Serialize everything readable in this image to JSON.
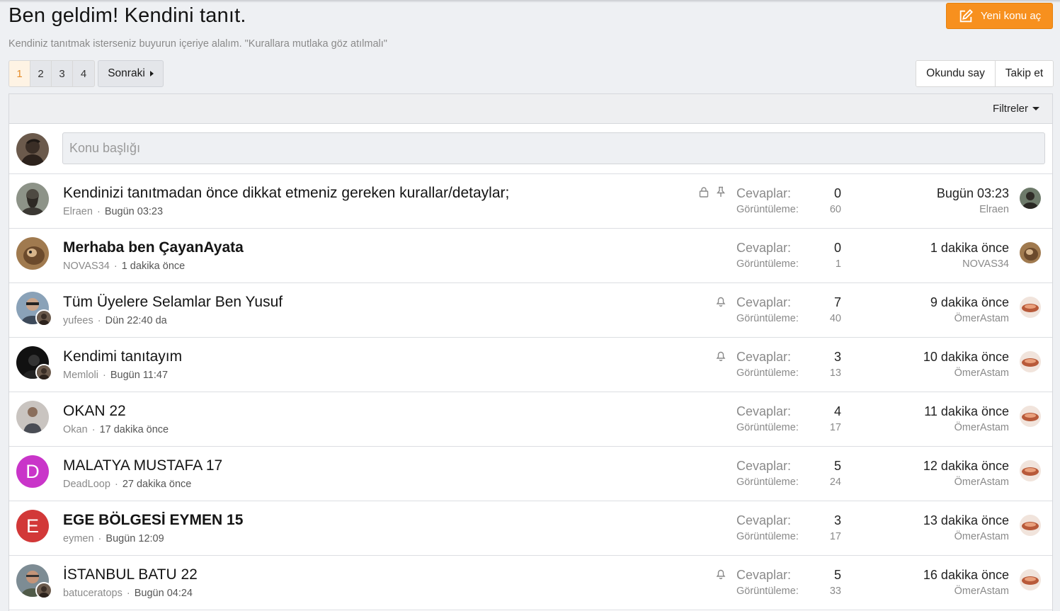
{
  "header": {
    "title": "Ben geldim! Kendini tanıt.",
    "description": "Kendiniz tanıtmak isterseniz buyurun içeriye alalım. \"Kurallara mutlaka göz atılmalı\"",
    "new_thread_label": "Yeni konu aç"
  },
  "pagination": {
    "pages": [
      "1",
      "2",
      "3",
      "4"
    ],
    "current": "1",
    "next_label": "Sonraki"
  },
  "actions": {
    "mark_read_label": "Okundu say",
    "watch_label": "Takip et"
  },
  "filters": {
    "label": "Filtreler"
  },
  "quick_thread": {
    "placeholder": "Konu başlığı"
  },
  "labels": {
    "replies": "Cevaplar:",
    "views": "Görüntüleme:"
  },
  "threads": [
    {
      "title": "Kendinizi tanıtmadan önce dikkat etmeniz gereken kurallar/detaylar;",
      "author": "Elraen",
      "date": "Bugün 03:23",
      "replies": "0",
      "views": "60",
      "last_date": "Bugün 03:23",
      "last_user": "Elraen",
      "unread": false,
      "icons": [
        "lock-icon",
        "pin-icon"
      ]
    },
    {
      "title": "Merhaba ben ÇayanAyata",
      "author": "NOVAS34",
      "date": "1 dakika önce",
      "replies": "0",
      "views": "1",
      "last_date": "1 dakika önce",
      "last_user": "NOVAS34",
      "unread": true,
      "icons": []
    },
    {
      "title": "Tüm Üyelere Selamlar Ben Yusuf",
      "author": "yufees",
      "date": "Dün 22:40 da",
      "replies": "7",
      "views": "40",
      "last_date": "9 dakika önce",
      "last_user": "ÖmerAstam",
      "unread": false,
      "icons": [
        "bell-icon"
      ]
    },
    {
      "title": "Kendimi tanıtayım",
      "author": "Memloli",
      "date": "Bugün 11:47",
      "replies": "3",
      "views": "13",
      "last_date": "10 dakika önce",
      "last_user": "ÖmerAstam",
      "unread": false,
      "icons": [
        "bell-icon"
      ]
    },
    {
      "title": "OKAN 22",
      "author": "Okan",
      "date": "17 dakika önce",
      "replies": "4",
      "views": "17",
      "last_date": "11 dakika önce",
      "last_user": "ÖmerAstam",
      "unread": false,
      "icons": []
    },
    {
      "title": "MALATYA MUSTAFA 17",
      "author": "DeadLoop",
      "date": "27 dakika önce",
      "replies": "5",
      "views": "24",
      "last_date": "12 dakika önce",
      "last_user": "ÖmerAstam",
      "unread": false,
      "icons": []
    },
    {
      "title": "EGE BÖLGESİ EYMEN 15",
      "author": "eymen",
      "date": "Bugün 12:09",
      "replies": "3",
      "views": "17",
      "last_date": "13 dakika önce",
      "last_user": "ÖmerAstam",
      "unread": true,
      "icons": []
    },
    {
      "title": "İSTANBUL BATU 22",
      "author": "batuceratops",
      "date": "Bugün 04:24",
      "replies": "5",
      "views": "33",
      "last_date": "16 dakika önce",
      "last_user": "ÖmerAstam",
      "unread": false,
      "icons": [
        "bell-icon"
      ]
    }
  ],
  "avatars": {
    "d_letter": "D",
    "e_letter": "E",
    "d_color": "#c935c9",
    "e_color": "#d23838",
    "accent": "#f7901e"
  }
}
